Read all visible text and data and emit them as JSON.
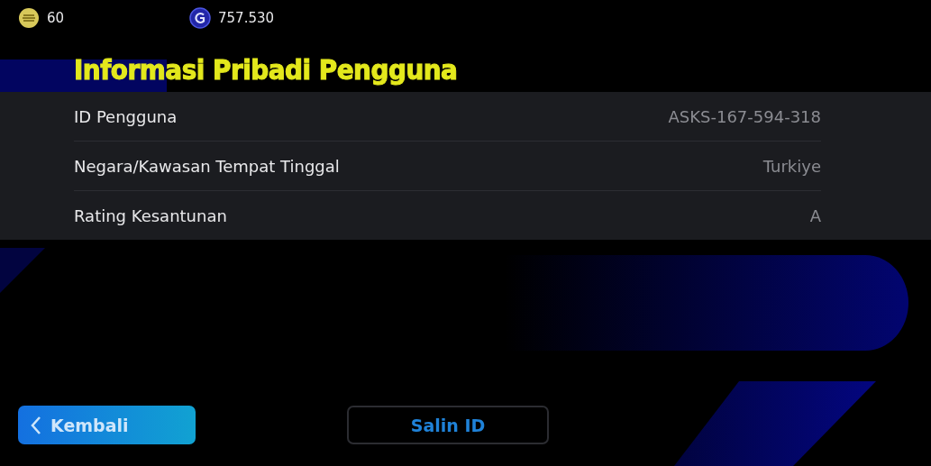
{
  "currencies": [
    {
      "kind": "coin",
      "amount": "60"
    },
    {
      "kind": "gp",
      "amount": "757.530"
    }
  ],
  "title": "Informasi Pribadi Pengguna",
  "rows": [
    {
      "label": "ID Pengguna",
      "value": "ASKS-167-594-318"
    },
    {
      "label": "Negara/Kawasan Tempat Tinggal",
      "value": "Turkiye"
    },
    {
      "label": "Rating Kesantunan",
      "value": "A"
    }
  ],
  "buttons": [
    {
      "kind": "back",
      "label": "Kembali"
    },
    {
      "kind": "outline",
      "label": "Salin ID"
    }
  ]
}
